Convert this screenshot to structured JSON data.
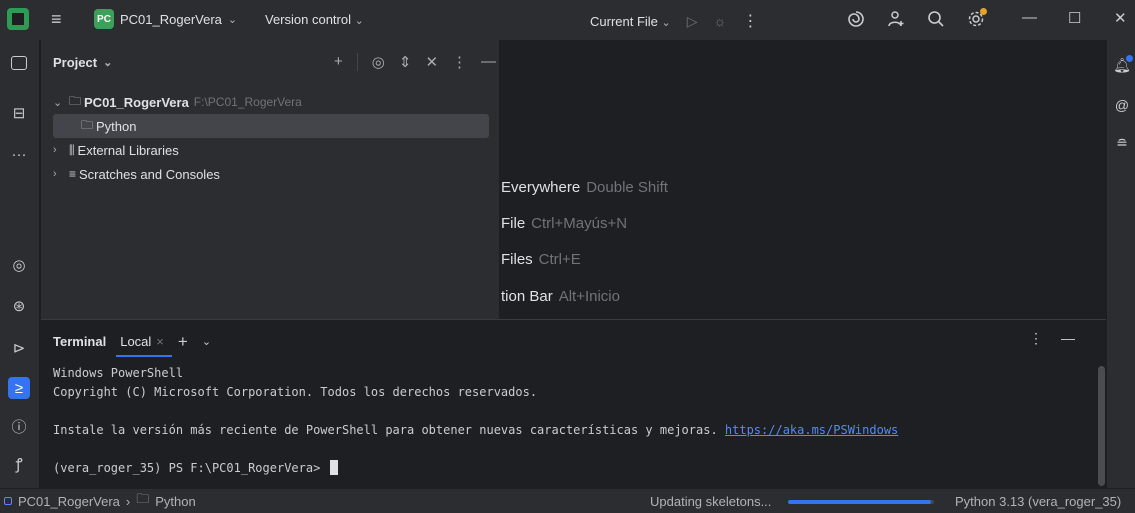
{
  "titlebar": {
    "project_badge": "PC",
    "project_name": "PC01_RogerVera",
    "vcs_label": "Version control",
    "run_config": "Current File"
  },
  "project_panel": {
    "header": "Project",
    "tree": [
      {
        "label": "PC01_RogerVera",
        "path": "F:\\PC01_RogerVera"
      },
      {
        "label": "Python"
      },
      {
        "label": "External Libraries"
      },
      {
        "label": "Scratches and Consoles"
      }
    ]
  },
  "editor_hints": [
    {
      "label": "Everywhere",
      "key": "Double Shift"
    },
    {
      "label": "File",
      "key": "Ctrl+Mayús+N"
    },
    {
      "label": "Files",
      "key": "Ctrl+E"
    },
    {
      "label": "tion Bar",
      "key": "Alt+Inicio"
    }
  ],
  "terminal": {
    "title": "Terminal",
    "tab_label": "Local",
    "lines": {
      "l1": "Windows PowerShell",
      "l2": "Copyright (C) Microsoft Corporation. Todos los derechos reservados.",
      "l4": "Instale la versión más reciente de PowerShell para obtener nuevas características y mejoras. ",
      "link": "https://aka.ms/PSWindows",
      "prompt": "(vera_roger_35) PS F:\\PC01_RogerVera> "
    }
  },
  "statusbar": {
    "crumb_project": "PC01_RogerVera",
    "crumb_folder": "Python",
    "progress_label": "Updating skeletons...",
    "progress_fraction": 0.98,
    "interpreter": "Python 3.13 (vera_roger_35)"
  },
  "colors": {
    "accent": "#3574f0",
    "panel": "#2b2d30",
    "background": "#1e1f22",
    "link": "#548af7",
    "notification_dot": "#e5a32e"
  }
}
